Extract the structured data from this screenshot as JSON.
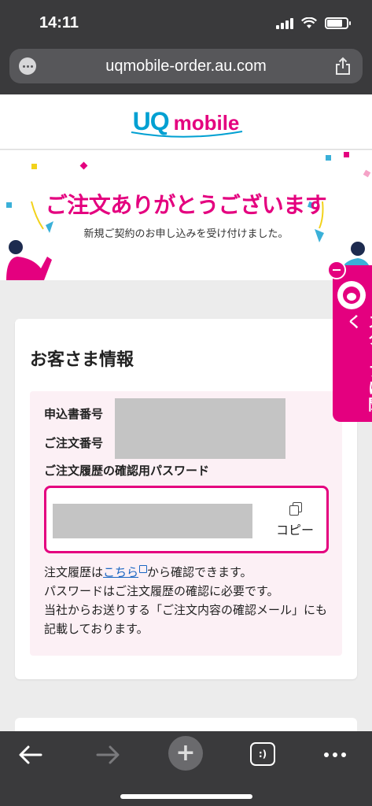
{
  "status_bar": {
    "time": "14:11"
  },
  "browser": {
    "url": "uqmobile-order.au.com",
    "more_icon": "more-icon",
    "share_icon": "share-icon"
  },
  "site": {
    "logo_uq": "UQ",
    "logo_mobile": "mobile"
  },
  "hero": {
    "title": "ご注文ありがとうございます",
    "subtitle": "新規ご契約のお申し込みを受け付けました。"
  },
  "customer_info": {
    "title": "お客さま情報",
    "application_number_label": "申込書番号",
    "order_number_label": "ご注文番号",
    "password_label": "ご注文履歴の確認用パスワード",
    "copy_label": "コピー",
    "note_prefix": "注文履歴は",
    "note_link": "こちら",
    "note_suffix": "から確認できます。",
    "note_line2": "パスワードはご注文履歴の確認に必要です。",
    "note_line3": "当社からお送りする「ご注文内容の確認メール」にも記載しております。"
  },
  "staff_tab": {
    "label": "スタッフに聞く"
  },
  "colors": {
    "accent": "#e4007f",
    "brand_blue": "#00a0d2",
    "link": "#1a66c2"
  }
}
